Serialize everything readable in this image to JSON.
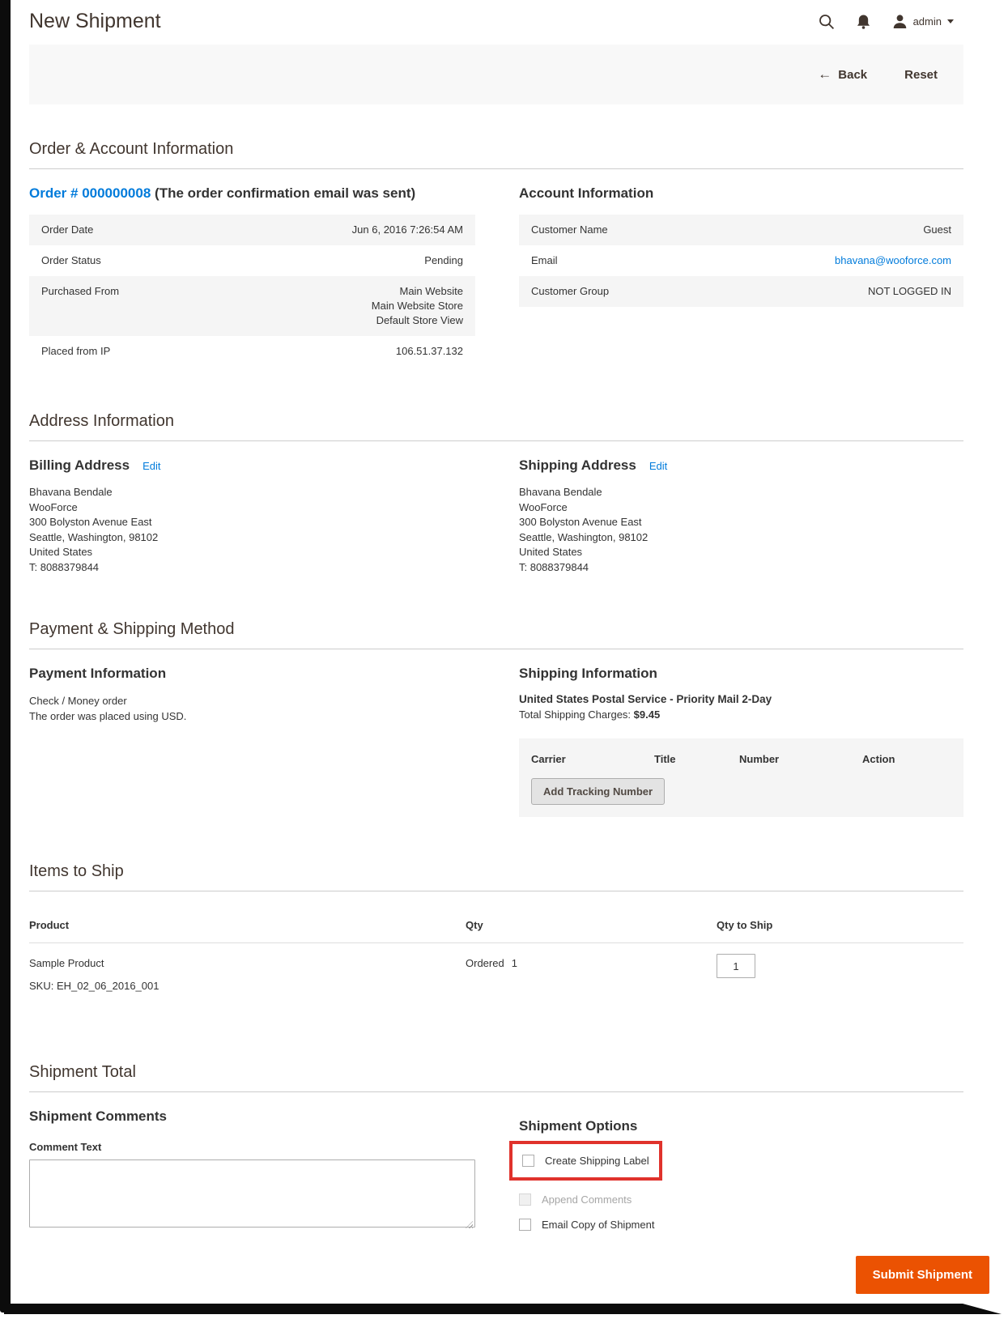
{
  "header": {
    "title": "New Shipment",
    "user_label": "admin"
  },
  "toolbar": {
    "back_arrow": "←",
    "back_label": "Back",
    "reset_label": "Reset"
  },
  "order_account": {
    "section_title": "Order & Account Information",
    "order_link": "Order # 000000008",
    "order_note": "(The order confirmation email was sent)",
    "rows": [
      {
        "label": "Order Date",
        "value": "Jun 6, 2016 7:26:54 AM"
      },
      {
        "label": "Order Status",
        "value": "Pending"
      },
      {
        "label": "Purchased From",
        "lines": [
          "Main Website",
          "Main Website Store",
          "Default Store View"
        ]
      },
      {
        "label": "Placed from IP",
        "value": "106.51.37.132"
      }
    ],
    "account": {
      "title": "Account Information",
      "rows": [
        {
          "label": "Customer Name",
          "value": "Guest"
        },
        {
          "label": "Email",
          "value": "bhavana@wooforce.com"
        },
        {
          "label": "Customer Group",
          "value": "NOT LOGGED IN"
        }
      ]
    }
  },
  "address": {
    "section_title": "Address Information",
    "billing": {
      "title": "Billing Address",
      "edit_label": "Edit",
      "lines": [
        "Bhavana Bendale",
        "WooForce",
        "300 Bolyston Avenue East",
        "Seattle, Washington, 98102",
        "United States",
        "T: 8088379844"
      ]
    },
    "shipping": {
      "title": "Shipping Address",
      "edit_label": "Edit",
      "lines": [
        "Bhavana Bendale",
        "WooForce",
        "300 Bolyston Avenue East",
        "Seattle, Washington, 98102",
        "United States",
        "T: 8088379844"
      ]
    }
  },
  "payment_shipping": {
    "section_title": "Payment & Shipping Method",
    "payment": {
      "title": "Payment Information",
      "method": "Check / Money order",
      "note": "The order was placed using USD."
    },
    "shipping": {
      "title": "Shipping Information",
      "method": "United States Postal Service - Priority Mail 2-Day",
      "charges_label": "Total Shipping Charges:",
      "charges_value": "$9.45",
      "tracking_headers": [
        "Carrier",
        "Title",
        "Number",
        "Action"
      ],
      "add_tracking_label": "Add Tracking Number"
    }
  },
  "items": {
    "section_title": "Items to Ship",
    "col_product": "Product",
    "col_qty": "Qty",
    "col_qty_to_ship": "Qty to Ship",
    "row": {
      "product": "Sample Product",
      "sku": "SKU: EH_02_06_2016_001",
      "qty_label": "Ordered",
      "qty_value": "1",
      "qty_to_ship_value": "1"
    }
  },
  "shipment_total": {
    "section_title": "Shipment Total",
    "comments_title": "Shipment Comments",
    "comment_label": "Comment Text",
    "options_title": "Shipment Options",
    "option_create_label": "Create Shipping Label",
    "option_append_label": "Append Comments",
    "option_email_label": "Email Copy of Shipment",
    "submit_label": "Submit Shipment"
  },
  "colors": {
    "accent_orange": "#eb5202",
    "link_blue": "#007bdb",
    "highlight_red": "#e0322c",
    "stripe_grey": "#f5f5f5"
  }
}
